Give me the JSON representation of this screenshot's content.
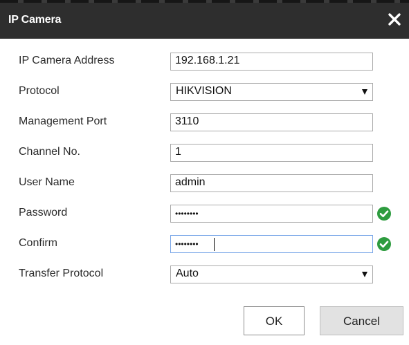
{
  "dialog": {
    "title": "IP Camera",
    "close_icon": "close-icon"
  },
  "form": {
    "ip_address": {
      "label": "IP Camera Address",
      "value": "192.168.1.21"
    },
    "protocol": {
      "label": "Protocol",
      "value": "HIKVISION"
    },
    "management_port": {
      "label": "Management Port",
      "value": "3110"
    },
    "channel_no": {
      "label": "Channel No.",
      "value": "1"
    },
    "user_name": {
      "label": "User Name",
      "value": "admin"
    },
    "password": {
      "label": "Password",
      "value": "••••••••",
      "valid_icon": "check-circle-icon"
    },
    "confirm": {
      "label": "Confirm",
      "value": "••••••••",
      "valid_icon": "check-circle-icon"
    },
    "transfer_protocol": {
      "label": "Transfer Protocol",
      "value": "Auto"
    }
  },
  "buttons": {
    "ok": "OK",
    "cancel": "Cancel"
  },
  "colors": {
    "titlebar": "#2e2e2e",
    "valid": "#2e9c3f",
    "focus_border": "#7aa7e8"
  }
}
